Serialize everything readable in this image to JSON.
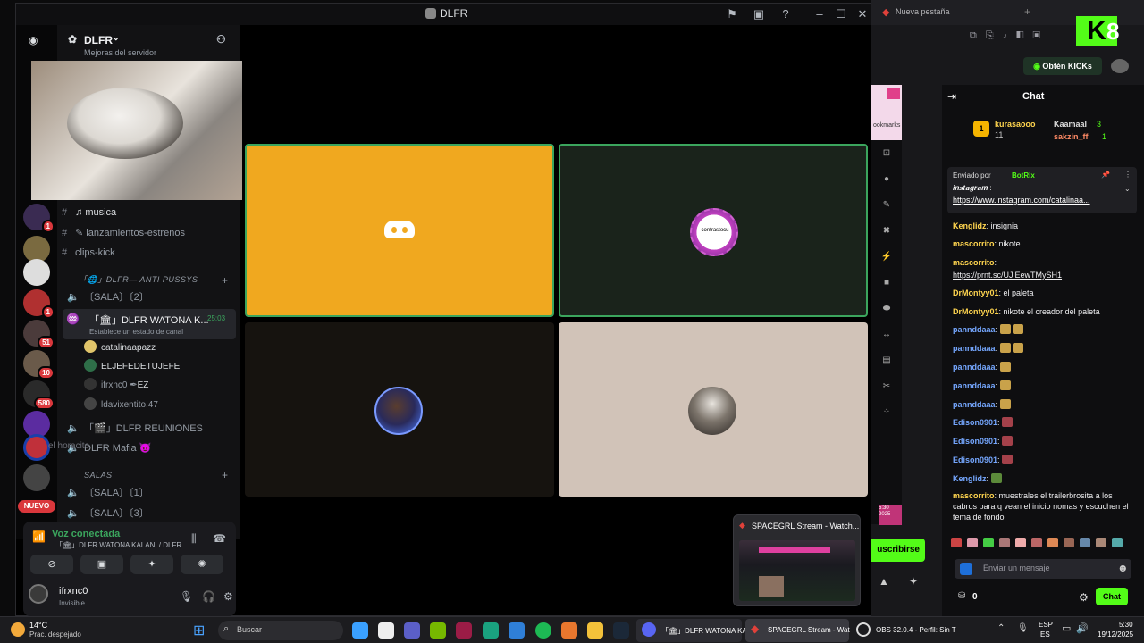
{
  "discord": {
    "window_title": "DLFR",
    "guild_name": "DLFR",
    "guild_subtitle": "Mejoras del servidor",
    "channels": [
      {
        "name": "musica"
      },
      {
        "name": "lanzamientos-estrenos"
      },
      {
        "name": "clips-kick"
      }
    ],
    "category_1": "「🌐」DLFR— ANTI PUSSYS",
    "voice_channels": [
      {
        "name": "〔SALA〕〔2〕"
      },
      {
        "name": "「🏛」DLFR WATONA K...",
        "timer": "25:03",
        "status": "Establece un estado de canal"
      }
    ],
    "members": [
      {
        "name": "catalinaapazz"
      },
      {
        "name": "ELJEFEDETUJEFE"
      },
      {
        "name": "ifrxnc0",
        "tag": "EZ"
      },
      {
        "name": "ldavixentito.47"
      }
    ],
    "more_voice": [
      {
        "name": "「🎬」DLFR REUNIONES"
      },
      {
        "name": "DLFR Mafia 😈"
      }
    ],
    "overlay_text": "el horacito",
    "category_2": "SALAS",
    "salas": [
      {
        "name": "〔SALA〕〔1〕"
      },
      {
        "name": "〔SALA〕〔3〕"
      }
    ],
    "server_badges": [
      "1",
      "1",
      "51",
      "10",
      "580"
    ],
    "new_label": "NUEVO",
    "voice_status": "Voz conectada",
    "voice_channel": "「🏛」DLFR WATONA KALANI / DLFR",
    "user_name": "ifrxnc0",
    "user_status": "Invisible",
    "tile_avatar_text": "contrastocu"
  },
  "browser": {
    "tab_title": "Nueva pestaña",
    "kick_button": "Obtén KICKs",
    "chat_title": "Chat",
    "bookmarks": "ookmarks",
    "gifters": [
      {
        "name": "kurasaooo",
        "count": "11"
      },
      {
        "name": "Kaamaal",
        "count": "3"
      },
      {
        "name": "sakzin_ff",
        "count": "1"
      }
    ],
    "pinned": {
      "by_label": "Enviado por",
      "by_user": "BotRix",
      "title": "𝒊𝒏𝒔𝒕𝒂𝒈𝒓𝒂𝒎 :",
      "link": "https://www.instagram.com/catalinaa..."
    },
    "messages": [
      {
        "user": "Kenglidz",
        "text": "insignia",
        "color": "#ffd54f"
      },
      {
        "user": "mascorrito",
        "text": "nikote",
        "color": "#ffd54f"
      },
      {
        "user": "mascorrito",
        "text": "",
        "color": "#ffd54f"
      },
      {
        "user": "",
        "text": "https://prnt.sc/UJlEewTMySH1",
        "color": "#ffffff"
      },
      {
        "user": "DrMontyy01",
        "text": "el paleta",
        "color": "#ffd54f"
      },
      {
        "user": "DrMontyy01",
        "text": "nikote el creador del paleta",
        "color": "#ffd54f"
      },
      {
        "user": "pannddaaa",
        "text": "",
        "color": "#75a7ff"
      },
      {
        "user": "pannddaaa",
        "text": "",
        "color": "#75a7ff"
      },
      {
        "user": "pannddaaa",
        "text": "",
        "color": "#75a7ff"
      },
      {
        "user": "pannddaaa",
        "text": "",
        "color": "#75a7ff"
      },
      {
        "user": "pannddaaa",
        "text": "",
        "color": "#75a7ff"
      },
      {
        "user": "Edison0901",
        "text": "",
        "color": "#75a7ff"
      },
      {
        "user": "Edison0901",
        "text": "",
        "color": "#75a7ff"
      },
      {
        "user": "Edison0901",
        "text": "",
        "color": "#75a7ff"
      },
      {
        "user": "Kenglidz",
        "text": "",
        "color": "#75a7ff"
      }
    ],
    "last_message": {
      "user": "mascorrito",
      "text": "muestrales el trailerbrosita a los cabros para q vean el inicio nomas y escuchen el tema de fondo"
    },
    "input_placeholder": "Enviar un mensaje",
    "subscribe_label": "uscribirse",
    "points": "0",
    "chat_button": "Chat",
    "side_time": "5:30\n2025"
  },
  "preview": {
    "title": "SPACEGRL Stream - Watch..."
  },
  "taskbar": {
    "weather_temp": "14°C",
    "weather_desc": "Prac. despejado",
    "search": "Buscar",
    "app_discord": "「🏛」DLFR WATONA KA",
    "app_browser": "SPACEGRL Stream - Wat",
    "app_obs": "OBS 32.0.4 - Perfil: Sin T",
    "lang1": "ESP",
    "lang2": "ES",
    "time": "5:30",
    "date": "19/12/2025"
  },
  "kick_logo_number": "8"
}
